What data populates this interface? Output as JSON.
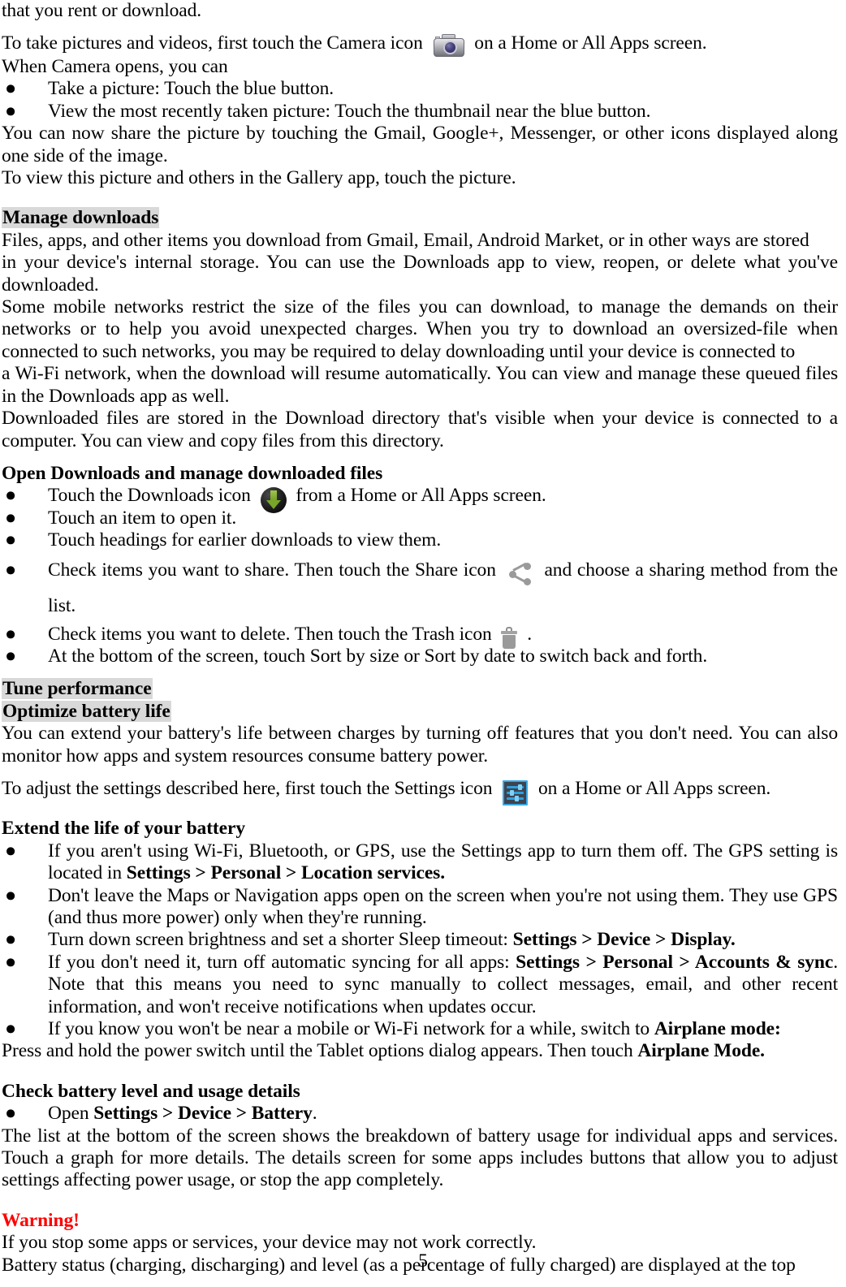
{
  "document": {
    "page_number": "5",
    "colors": {
      "highlight": "#d9d9d9",
      "warning": "#ff0000",
      "text": "#000000",
      "download_arrow_green": "#79a62a",
      "settings_blue": "#2f9fe0",
      "icon_gray": "#9a9a9a"
    }
  },
  "intro": {
    "line_1": "that you rent or download.",
    "camera_sentence_before": "To take pictures and videos, first touch the Camera icon",
    "camera_sentence_after": "on a Home or All Apps screen.",
    "camera_icon": "camera-icon",
    "when_camera_opens": "When Camera opens, you can",
    "bullets": [
      "Take a picture: Touch the blue button.",
      "View the most recently taken picture: Touch the thumbnail near the blue button."
    ],
    "share_paragraph": "You can now share the picture by touching the Gmail, Google+, Messenger, or other icons displayed along one side of the image.",
    "gallery_line": "To view this picture and others in the Gallery app, touch the picture."
  },
  "manage_downloads": {
    "heading": "Manage downloads",
    "highlighted": true,
    "paragraph_1": "Files, apps, and other items you download from Gmail, Email, Android Market, or in other ways are stored",
    "paragraph_2": "in your device's internal storage. You can use the Downloads app to view, reopen, or delete what you've downloaded.",
    "paragraph_3": "Some mobile networks restrict the size of the files you can download, to manage the demands on their networks or to help you avoid unexpected charges. When you try to download an oversized-file when connected to such networks, you may be required to delay downloading until your device is connected to",
    "paragraph_4": "a Wi-Fi network, when the download will resume automatically. You can view and manage these queued files in the Downloads app as well.",
    "paragraph_5": "Downloaded files are stored in the Download directory that's visible when your device is connected to a computer. You can view and copy files from this directory."
  },
  "open_downloads": {
    "heading": "Open Downloads and manage downloaded files",
    "highlighted": false,
    "bullet_downloads_before": "Touch the Downloads icon",
    "bullet_downloads_after": "from a Home or All Apps screen.",
    "downloads_icon": "download-icon",
    "bullet_open_item": "Touch an item to open it.",
    "bullet_headings": "Touch headings for earlier downloads to view them.",
    "bullet_share_before": "Check items you want to share. Then touch the Share icon",
    "bullet_share_after": "and choose a sharing method from the list.",
    "share_icon": "share-icon",
    "bullet_delete_before": "Check items you want to delete. Then touch the Trash icon",
    "bullet_delete_after": ".",
    "trash_icon": "trash-icon",
    "bullet_sort": "At the bottom of the screen, touch Sort by size or Sort by date to switch back and forth."
  },
  "tune_performance": {
    "heading": "Tune performance",
    "highlighted": true,
    "subheading": "Optimize battery life",
    "subheading_highlighted": true,
    "paragraph": "You can extend your battery's life between charges by turning off features that you don't need. You can also monitor how apps and system resources consume battery power.",
    "settings_sentence_before": "To adjust the settings described here, first touch the Settings icon",
    "settings_sentence_after": "on a Home or All Apps screen.",
    "settings_icon": "settings-icon"
  },
  "extend_battery": {
    "heading": "Extend the life of your battery",
    "highlighted": false,
    "bullet_1_a": "If you aren't using Wi-Fi, Bluetooth, or GPS, use the Settings app to turn them off. The GPS setting is located in ",
    "bullet_1_path": "Settings > Personal > Location services.",
    "bullet_2": "Don't leave the Maps or Navigation apps open on the screen when you're not using them. They use GPS (and thus more power) only when they're running.",
    "bullet_3_a": "Turn down screen brightness and set a shorter Sleep timeout: ",
    "bullet_3_path": "Settings > Device > Display.",
    "bullet_4_a": "If you don't need it, turn off automatic syncing for all apps: ",
    "bullet_4_path": "Settings > Personal > Accounts & sync",
    "bullet_4_b": ". Note that this means you need to sync manually to collect messages, email, and other recent information, and won't receive notifications when updates occur.",
    "bullet_5_a": "If you know you won't be near a mobile or Wi-Fi network for a while, switch to ",
    "bullet_5_path": "Airplane mode:",
    "trailing_a": "Press and hold the power switch until the Tablet options dialog appears. Then touch ",
    "trailing_bold": "Airplane Mode."
  },
  "check_battery": {
    "heading": "Check battery level and usage details",
    "highlighted": false,
    "bullet_a": "Open ",
    "bullet_path": "Settings > Device > Battery",
    "bullet_b": ".",
    "paragraph": "The list at the bottom of the screen shows the breakdown of battery usage for individual apps and services. Touch a graph for more details. The details screen for some apps includes buttons that allow you to adjust settings affecting power usage, or stop the app completely."
  },
  "warning": {
    "heading": "Warning!",
    "line_1": "If you stop some apps or services, your device may not work correctly.",
    "line_2": "Battery status (charging, discharging) and level (as a percentage of fully charged) are displayed at the top"
  }
}
